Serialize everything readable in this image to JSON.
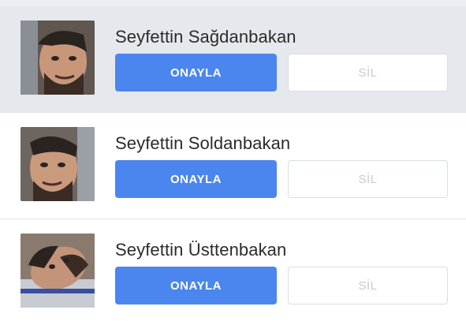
{
  "requests": [
    {
      "name": "Seyfettin Sağdanbakan",
      "confirm_label": "ONAYLA",
      "delete_label": "SİL",
      "avatar_icon": "profile-photo",
      "highlighted": true
    },
    {
      "name": "Seyfettin Soldanbakan",
      "confirm_label": "ONAYLA",
      "delete_label": "SİL",
      "avatar_icon": "profile-photo",
      "highlighted": false
    },
    {
      "name": "Seyfettin Üsttenbakan",
      "confirm_label": "ONAYLA",
      "delete_label": "SİL",
      "avatar_icon": "profile-photo",
      "highlighted": false
    }
  ],
  "colors": {
    "confirm_button": "#4b86ef",
    "highlight_row": "#e5e8ec",
    "delete_text": "#c6cacf"
  }
}
